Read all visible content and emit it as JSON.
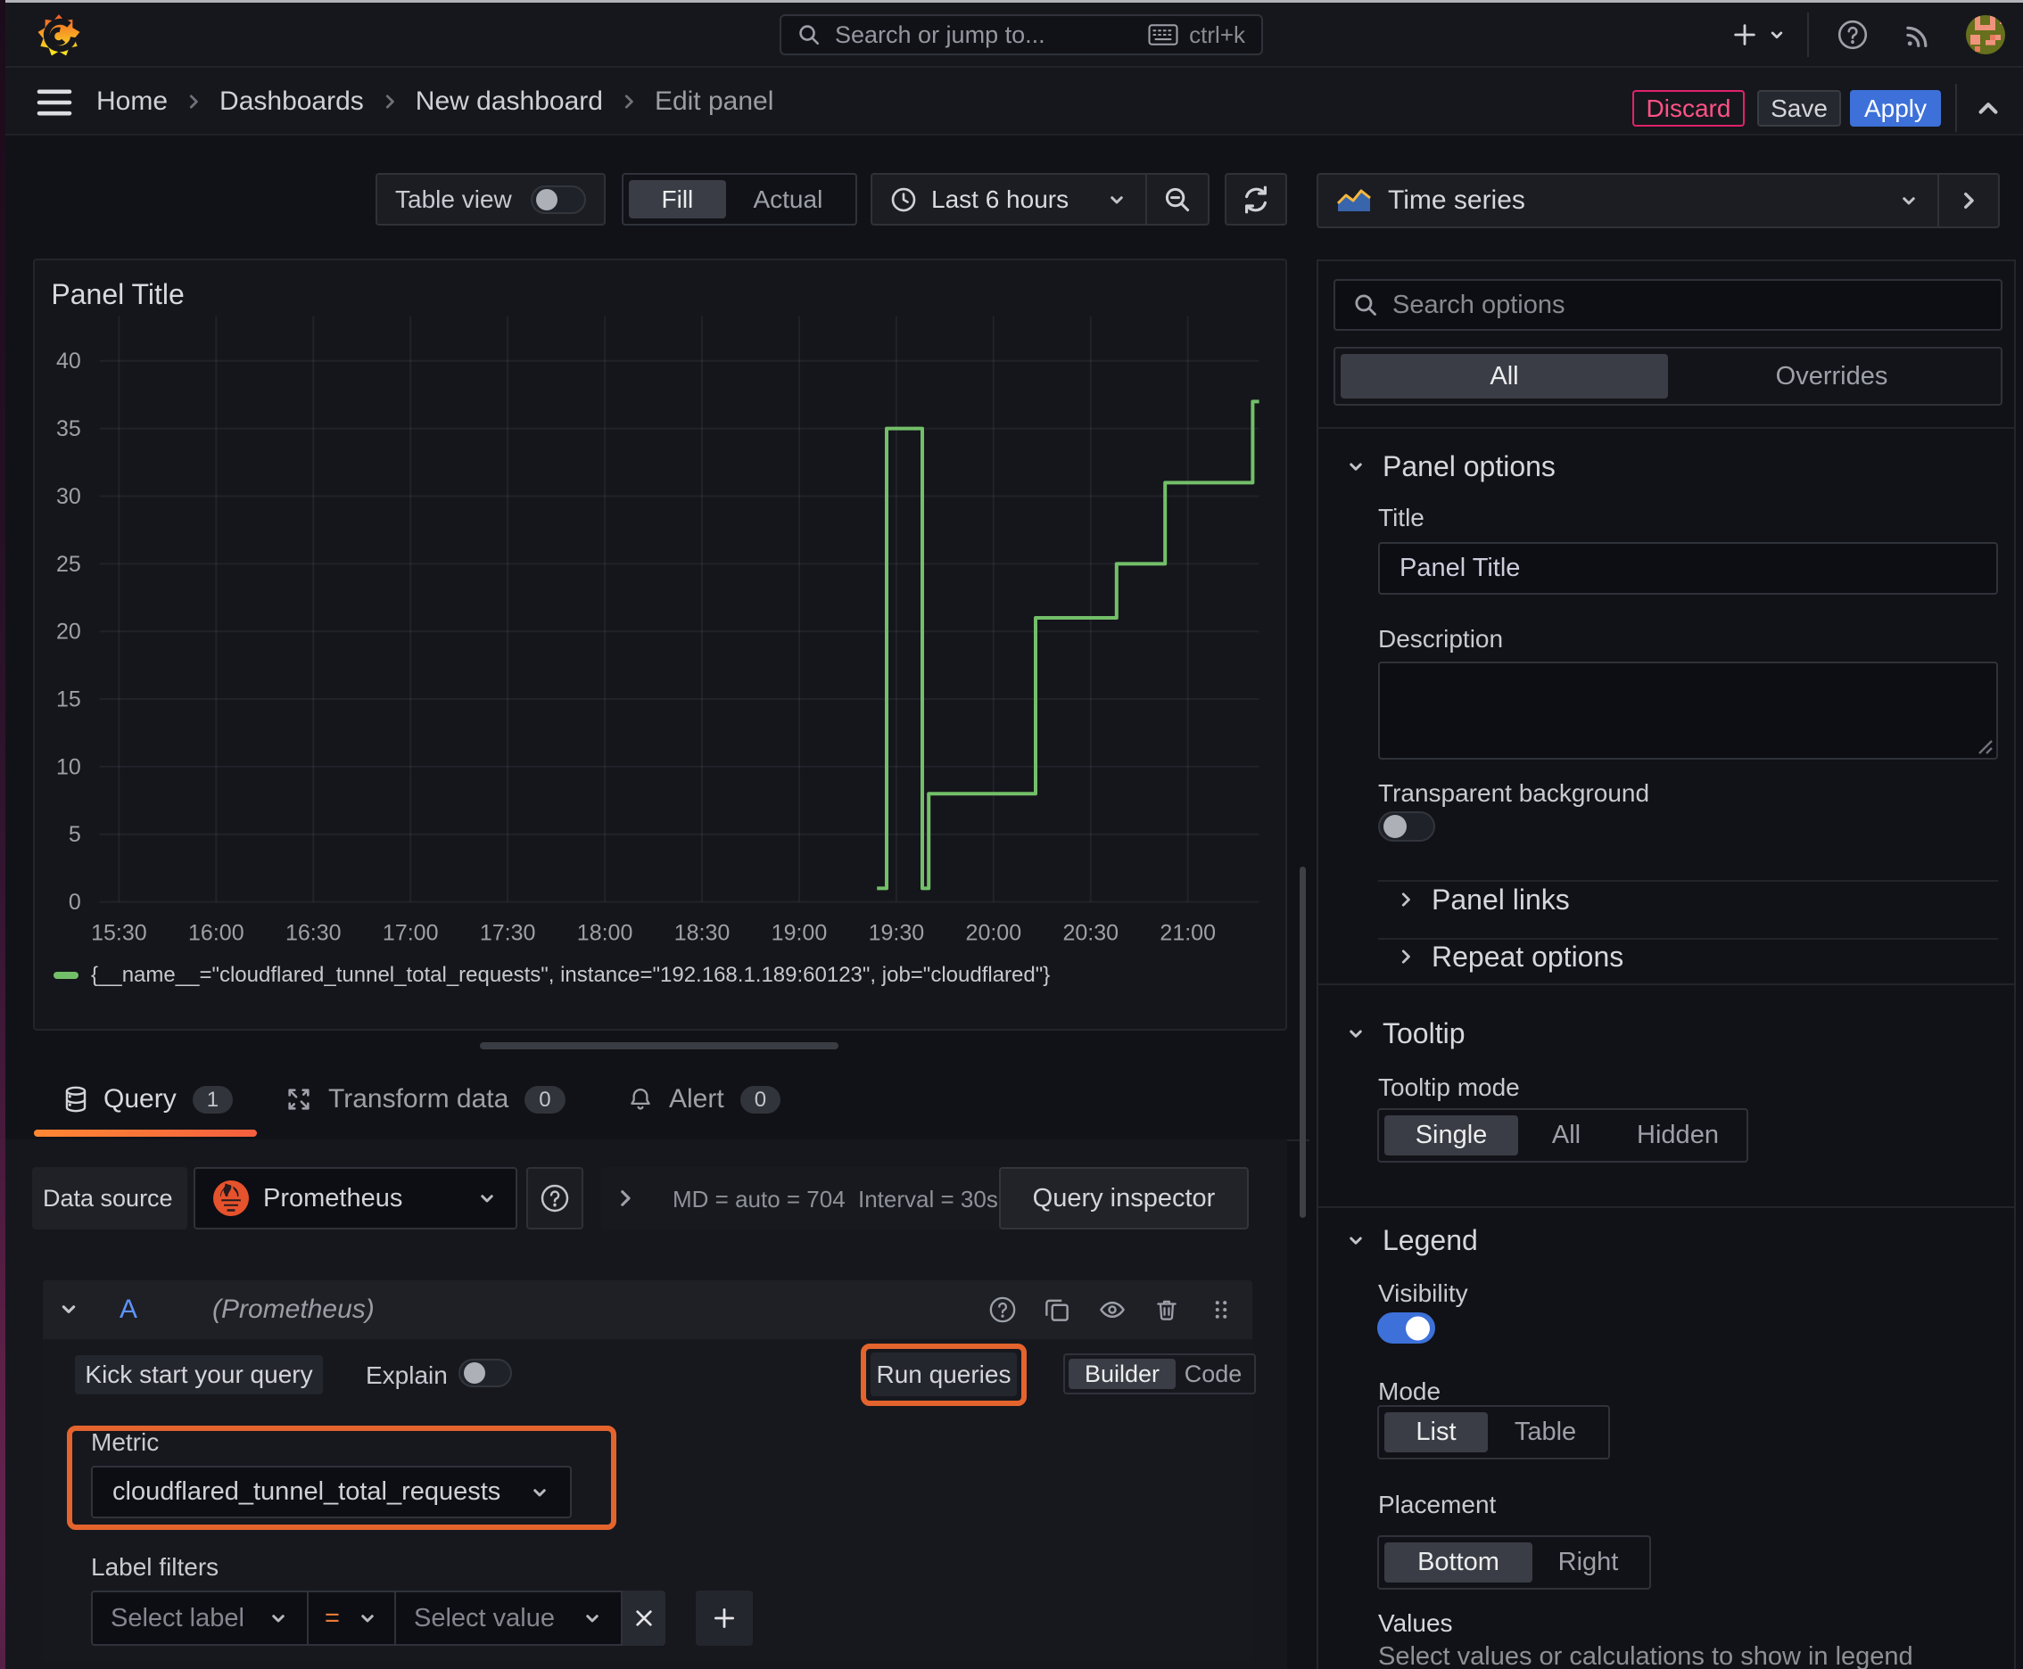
{
  "topbar": {
    "search_placeholder": "Search or jump to...",
    "shortcut": "ctrl+k"
  },
  "breadcrumb": {
    "items": [
      "Home",
      "Dashboards",
      "New dashboard"
    ],
    "current": "Edit panel",
    "discard_label": "Discard",
    "save_label": "Save",
    "apply_label": "Apply"
  },
  "toolbar": {
    "table_view_label": "Table view",
    "fill_label": "Fill",
    "actual_label": "Actual",
    "time_range_label": "Last 6 hours",
    "viz_picker_label": "Time series"
  },
  "panel": {
    "title": "Panel Title"
  },
  "chart_data": {
    "type": "line",
    "render": "step-after",
    "title": "Panel Title",
    "xlabel": "",
    "ylabel": "",
    "ylim": [
      0,
      40
    ],
    "y_ticks": [
      0,
      5,
      10,
      15,
      20,
      25,
      30,
      35,
      40
    ],
    "x_ticks": [
      "15:30",
      "16:00",
      "16:30",
      "17:00",
      "17:30",
      "18:00",
      "18:30",
      "19:00",
      "19:30",
      "20:00",
      "20:30",
      "21:00"
    ],
    "x_range": [
      "15:24",
      "21:22"
    ],
    "grid": true,
    "legend_position": "bottom",
    "line_color": "#73bf69",
    "series": [
      {
        "name": "{__name__=\"cloudflared_tunnel_total_requests\", instance=\"192.168.1.189:60123\", job=\"cloudflared\"}",
        "points": [
          [
            "19:24",
            1
          ],
          [
            "19:27",
            35
          ],
          [
            "19:38",
            1
          ],
          [
            "19:40",
            8
          ],
          [
            "20:13",
            21
          ],
          [
            "20:38",
            25
          ],
          [
            "20:53",
            31
          ],
          [
            "21:20",
            37
          ],
          [
            "21:22",
            37
          ]
        ]
      }
    ]
  },
  "tabs": {
    "query": {
      "label": "Query",
      "count": "1"
    },
    "transform": {
      "label": "Transform data",
      "count": "0"
    },
    "alert": {
      "label": "Alert",
      "count": "0"
    }
  },
  "query": {
    "datasource_label": "Data source",
    "datasource_name": "Prometheus",
    "stats_md": "MD = auto = 704",
    "stats_interval": "Interval = 30s",
    "inspector_label": "Query inspector",
    "row_letter": "A",
    "row_datasource_hint": "(Prometheus)",
    "kickstart_label": "Kick start your query",
    "explain_label": "Explain",
    "run_label": "Run queries",
    "builder_label": "Builder",
    "code_label": "Code",
    "metric_label": "Metric",
    "metric_value": "cloudflared_tunnel_total_requests",
    "label_filters_label": "Label filters",
    "select_label_placeholder": "Select label",
    "operator_value": "=",
    "select_value_placeholder": "Select value"
  },
  "options": {
    "search_placeholder": "Search options",
    "filter_all": "All",
    "filter_overrides": "Overrides",
    "panel_options": {
      "title": "Panel options",
      "title_label": "Title",
      "title_value": "Panel Title",
      "description_label": "Description",
      "description_value": "",
      "transparent_label": "Transparent background",
      "links_label": "Panel links",
      "repeat_label": "Repeat options"
    },
    "tooltip": {
      "title": "Tooltip",
      "mode_label": "Tooltip mode",
      "modes": [
        "Single",
        "All",
        "Hidden"
      ],
      "selected_mode": "Single"
    },
    "legend": {
      "title": "Legend",
      "visibility_label": "Visibility",
      "visibility_on": true,
      "mode_label": "Mode",
      "modes": [
        "List",
        "Table"
      ],
      "selected_mode": "List",
      "placement_label": "Placement",
      "placements": [
        "Bottom",
        "Right"
      ],
      "selected_placement": "Bottom",
      "values_label": "Values",
      "values_hint": "Select values or calculations to show in legend"
    }
  },
  "colors": {
    "accent_blue": "#3d71d9",
    "destructive_pink": "#ff5286",
    "highlight_orange": "#e4642e",
    "series_green": "#73bf69",
    "tab_gradient_left": "#ff8833",
    "tab_gradient_right": "#f55f3e"
  }
}
